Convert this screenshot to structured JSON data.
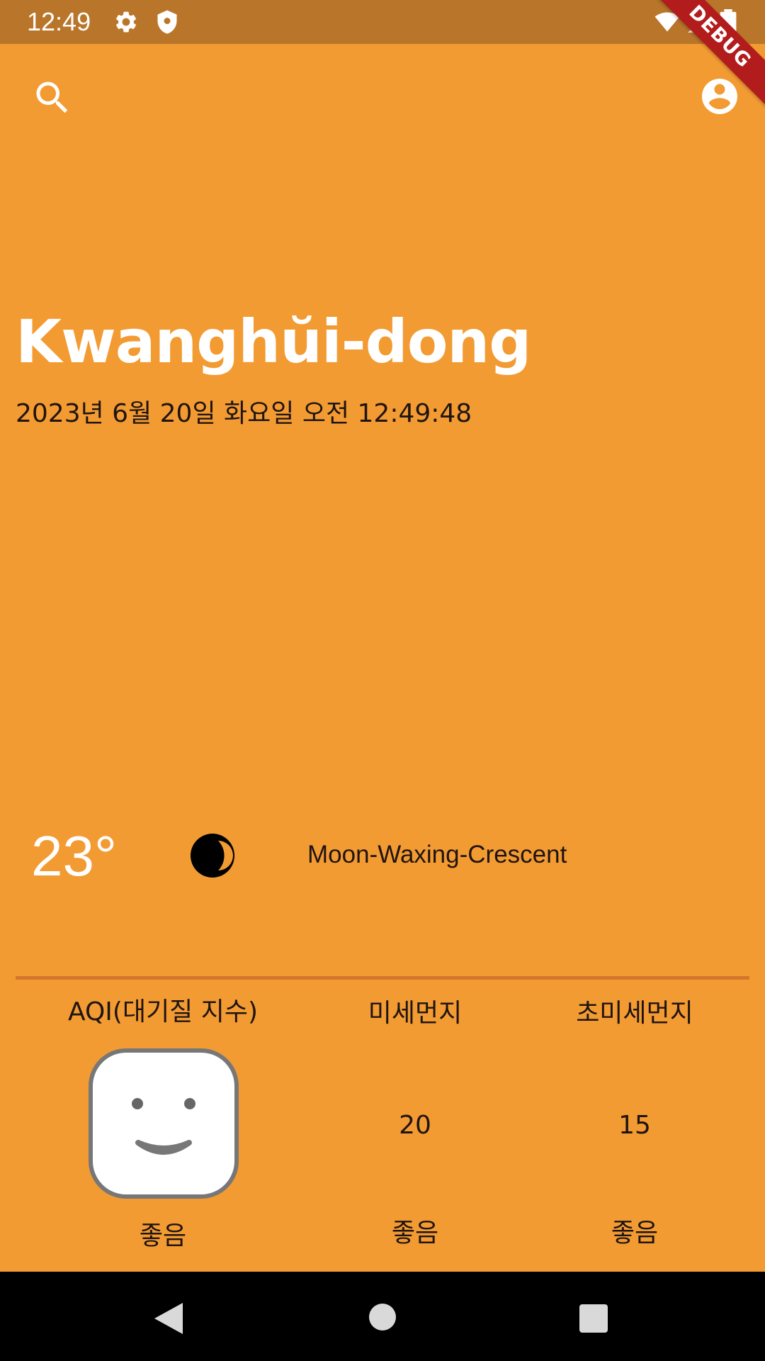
{
  "status_bar": {
    "time": "12:49",
    "icons": [
      "gear-icon",
      "shield-icon",
      "wifi-icon",
      "cell-signal-icon",
      "battery-icon"
    ],
    "debug_label": "DEBUG"
  },
  "header": {
    "search_icon": "search-icon",
    "account_icon": "account-circle-icon"
  },
  "location": {
    "city": "Kwanghŭi-dong",
    "datetime": "2023년 6월 20일 화요일 오전 12:49:48"
  },
  "weather": {
    "temperature": "23°",
    "icon": "moon-waxing-crescent-icon",
    "condition": "Moon-Waxing-Crescent"
  },
  "air_quality": {
    "aqi": {
      "label": "AQI(대기질 지수)",
      "icon": "smiley-face-icon",
      "status": "좋음"
    },
    "pm10": {
      "label": "미세먼지",
      "value": "20",
      "status": "좋음"
    },
    "pm25": {
      "label": "초미세먼지",
      "value": "15",
      "status": "좋음"
    }
  },
  "colors": {
    "background": "#f39b33",
    "status_bar": "#b9762a",
    "debug_banner": "#b31c1c",
    "divider": "#d4772c"
  },
  "nav_bar": {
    "buttons": [
      "back-icon",
      "home-icon",
      "recents-icon"
    ]
  }
}
